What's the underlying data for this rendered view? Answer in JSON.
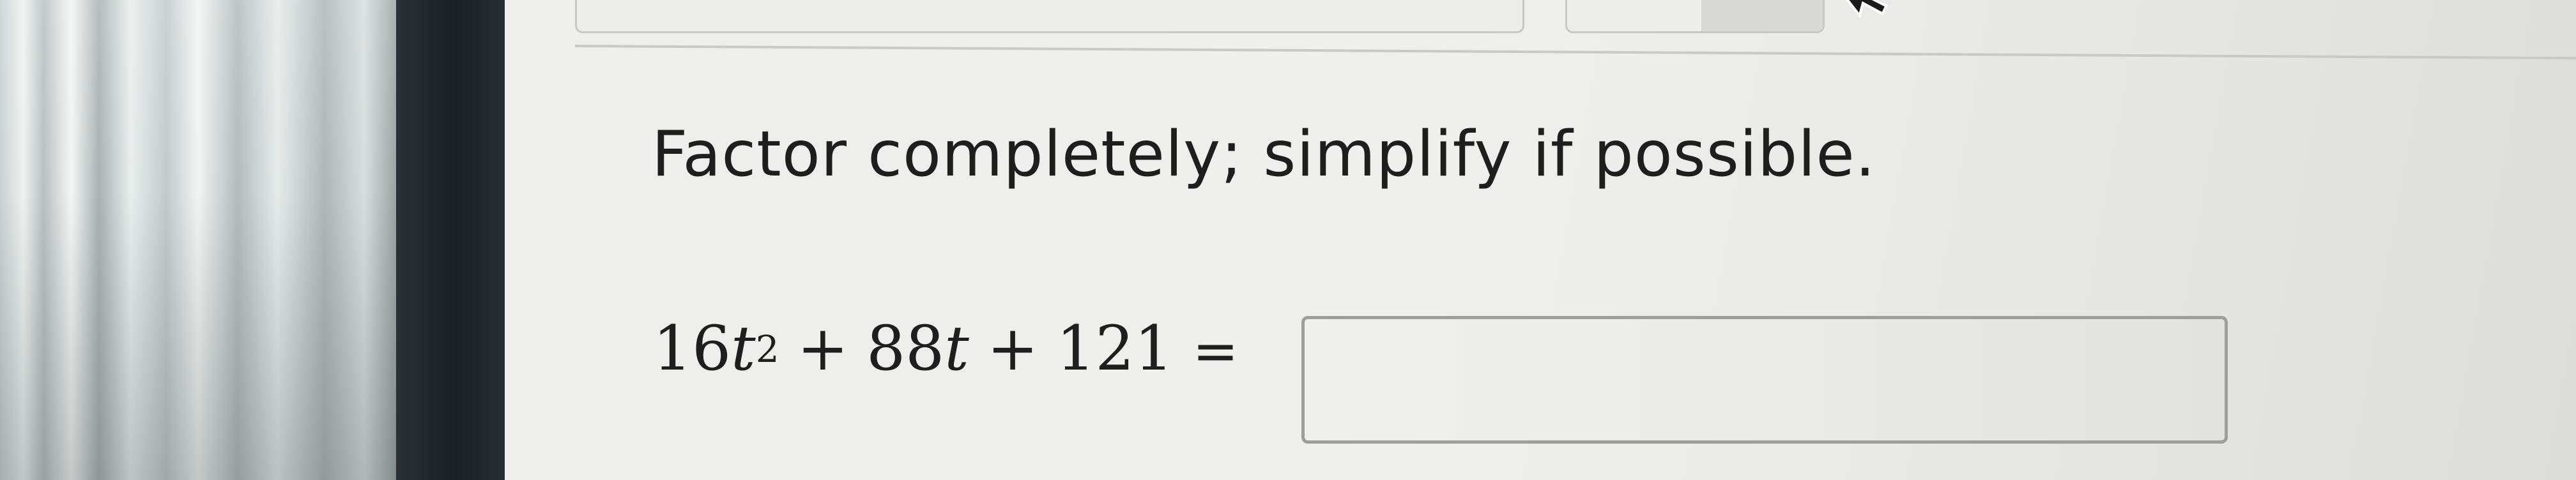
{
  "question": {
    "instruction": "Factor completely; simplify if possible."
  },
  "equation": {
    "coef1": "16",
    "var1": "t",
    "exponent": "2",
    "op1": "+",
    "coef2": "88",
    "var2": "t",
    "op2": "+",
    "const": "121",
    "equals": "="
  },
  "answer": {
    "value": ""
  },
  "icons": {
    "cursor": "mouse-pointer-icon"
  },
  "colors": {
    "screen_background": "#eeeeec",
    "text": "#1e1e1e",
    "answer_border": "#9e9e9c"
  }
}
